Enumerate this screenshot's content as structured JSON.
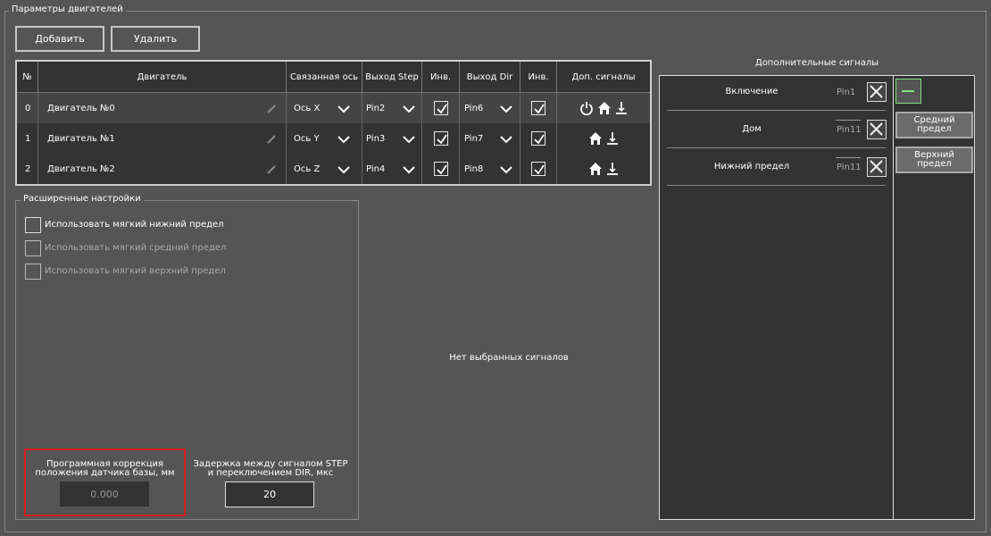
{
  "window": {
    "group_title": "Параметры двигателей"
  },
  "toolbar": {
    "add_label": "Добавить",
    "remove_label": "Удалить"
  },
  "table": {
    "headers": [
      "№",
      "Двигатель",
      "Связанная ось",
      "Выход Step",
      "Инв.",
      "Выход Dir",
      "Инв.",
      "Доп. сигналы"
    ],
    "rows": [
      {
        "num": "0",
        "name": "Двигатель №0",
        "axis": "Ось X",
        "step": "Pin2",
        "step_inv": true,
        "dir": "Pin6",
        "dir_inv": true,
        "signals": [
          "power-icon",
          "home-icon",
          "lower-limit-icon"
        ]
      },
      {
        "num": "1",
        "name": "Двигатель №1",
        "axis": "Ось Y",
        "step": "Pin3",
        "step_inv": true,
        "dir": "Pin7",
        "dir_inv": true,
        "signals": [
          "home-icon",
          "lower-limit-icon"
        ]
      },
      {
        "num": "2",
        "name": "Двигатель №2",
        "axis": "Ось Z",
        "step": "Pin4",
        "step_inv": true,
        "dir": "Pin8",
        "dir_inv": true,
        "signals": [
          "home-icon",
          "lower-limit-icon"
        ]
      }
    ]
  },
  "advanced": {
    "title": "Расширенные настройки",
    "options": [
      {
        "label": "Использовать мягкий нижний предел",
        "enabled": true,
        "checked": false
      },
      {
        "label": "Использовать мягкий средний предел",
        "enabled": false,
        "checked": false
      },
      {
        "label": "Использовать мягкий верхний предел",
        "enabled": false,
        "checked": false
      }
    ],
    "correction_label": "Программная коррекция положения датчика базы, мм",
    "correction_value": "0.000",
    "delay_label": "Задержка между сигналом STEP и переключением DIR, мкс",
    "delay_value": "20"
  },
  "center": {
    "empty_text": "Нет выбранных сигналов"
  },
  "signals_panel": {
    "title": "Дополнительные сигналы",
    "items": [
      {
        "label": "Включение",
        "pin": "Pin1"
      },
      {
        "label": "Дом",
        "pin": "Pin11"
      },
      {
        "label": "Нижний предел",
        "pin": "Pin11"
      }
    ],
    "available": [
      "Средний предел",
      "Верхний предел"
    ]
  },
  "colors": {
    "highlight_red": "#d42020",
    "accent_green": "#7fe07f"
  }
}
